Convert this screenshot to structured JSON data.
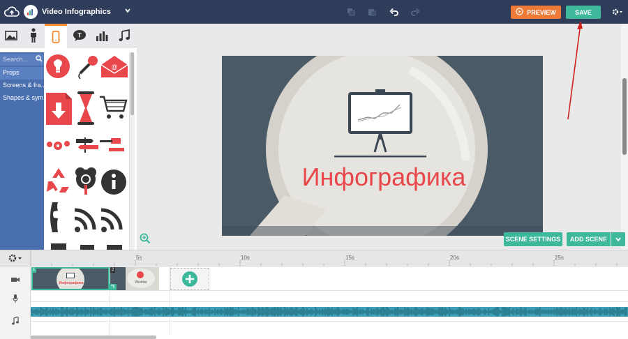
{
  "app": {
    "project_title": "Video Infographics"
  },
  "toolbar": {
    "preview_label": "PREVIEW",
    "save_label": "SAVE"
  },
  "library": {
    "search_placeholder": "Search...",
    "categories": [
      "Props",
      "Screens & fra...",
      "Shapes & sym..."
    ]
  },
  "slide": {
    "title_text": "Инфографика"
  },
  "workspace": {
    "scene_settings_label": "SCENE SETTINGS",
    "add_scene_label": "ADD SCENE"
  },
  "timeline": {
    "ticks": [
      "5s",
      "10s",
      "15s",
      "20s",
      "25s"
    ],
    "scenes": [
      {
        "number": "1",
        "thumb_title": "Инфографика"
      },
      {
        "number": "2",
        "thumb_title": "Wishlist"
      }
    ]
  },
  "colors": {
    "topbar": "#2f3d5a",
    "accent_orange": "#ee7a38",
    "accent_green": "#3db89a",
    "category_panel": "#4a6fae",
    "icon_red": "#e8474c",
    "slide_bg": "#4a5a66",
    "slide_title": "#e8474c",
    "waveform": "#3da0b8",
    "annotation_arrow": "#d22020"
  }
}
